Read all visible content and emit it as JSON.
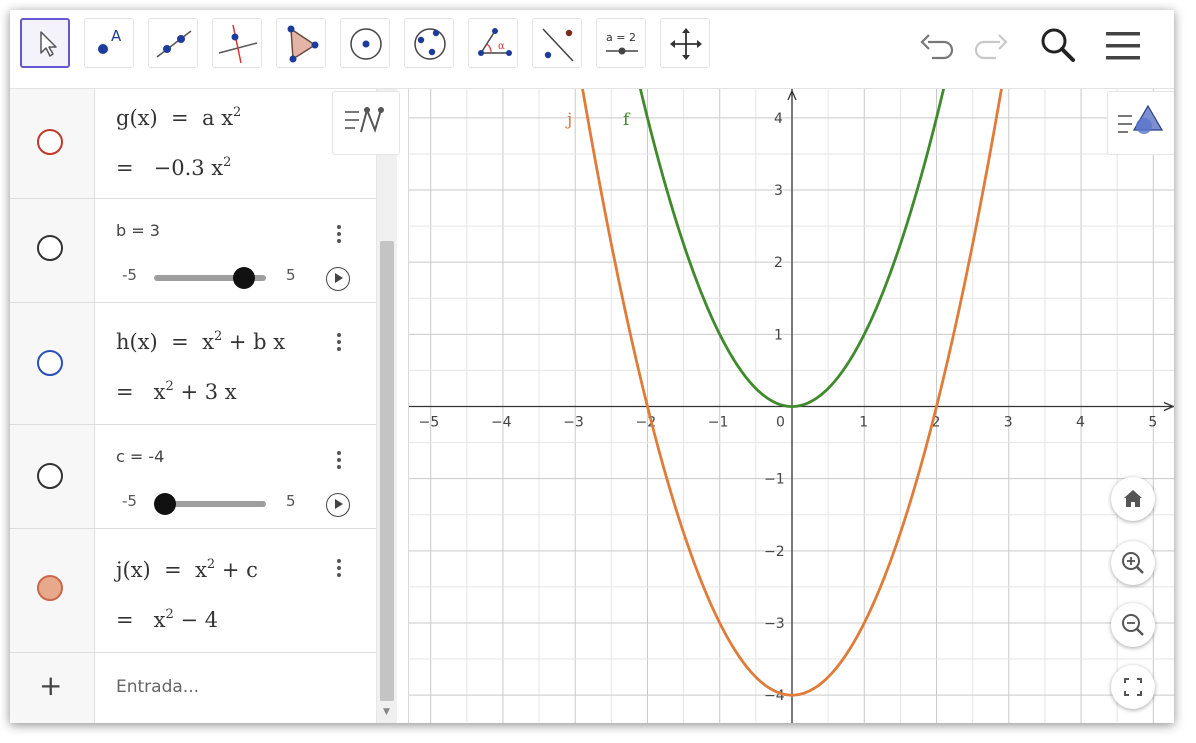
{
  "toolbar": {
    "tools": [
      {
        "name": "move-tool",
        "icon": "arrow-cursor-icon",
        "active": true
      },
      {
        "name": "point-tool",
        "icon": "point-icon",
        "label": "A"
      },
      {
        "name": "line-tool",
        "icon": "line-icon"
      },
      {
        "name": "perpendicular-line-tool",
        "icon": "perpendicular-line-icon"
      },
      {
        "name": "polygon-tool",
        "icon": "polygon-icon"
      },
      {
        "name": "circle-center-point-tool",
        "icon": "circle-center-icon"
      },
      {
        "name": "circle-three-points-tool",
        "icon": "circle-three-points-icon"
      },
      {
        "name": "angle-tool",
        "icon": "angle-icon",
        "label": "α"
      },
      {
        "name": "reflect-tool",
        "icon": "reflect-icon"
      },
      {
        "name": "slider-tool",
        "icon": "slider-icon",
        "label": "a = 2"
      },
      {
        "name": "move-graphics-view-tool",
        "icon": "move-arrows-icon"
      }
    ],
    "right": [
      "undo-icon",
      "redo-icon",
      "search-icon",
      "menu-icon"
    ]
  },
  "algebra": {
    "rows": [
      {
        "kind": "function",
        "marker_color": "#c0392b",
        "marker_filled": false,
        "def_name": "g(x)",
        "def_op": "=",
        "def_body": "a x",
        "def_sup": "2",
        "res_eq": "=",
        "res_body": "−0.3 x",
        "res_sup": "2"
      },
      {
        "kind": "slider",
        "marker_color": "#333333",
        "marker_filled": false,
        "label": "b = 3",
        "min": "-5",
        "max": "5",
        "value": 3,
        "range": [
          -5,
          5
        ]
      },
      {
        "kind": "function",
        "marker_color": "#2a4fb6",
        "marker_filled": false,
        "def_name": "h(x)",
        "def_op": "=",
        "def_body": "x",
        "def_sup": "2",
        "def_tail": " + b x",
        "res_eq": "=",
        "res_body": "x",
        "res_sup": "2",
        "res_tail": " + 3 x"
      },
      {
        "kind": "slider",
        "marker_color": "#333333",
        "marker_filled": false,
        "label": "c = -4",
        "min": "-5",
        "max": "5",
        "value": -4,
        "range": [
          -5,
          5
        ]
      },
      {
        "kind": "function",
        "marker_color": "#e2987a",
        "marker_filled": true,
        "def_name": "j(x)",
        "def_op": "=",
        "def_body": "x",
        "def_sup": "2",
        "def_tail": " + c",
        "res_eq": "=",
        "res_body": "x",
        "res_sup": "2",
        "res_tail": " − 4"
      }
    ],
    "input": {
      "plus": "+",
      "placeholder": "Entrada..."
    }
  },
  "graph": {
    "x_ticks": [
      "−5",
      "−4",
      "−3",
      "−2",
      "−1",
      "0",
      "1",
      "2",
      "3",
      "4",
      "5"
    ],
    "y_ticks": [
      "4",
      "3",
      "2",
      "1",
      "−1",
      "−2",
      "−3",
      "−4"
    ],
    "x_range": [
      -5.3,
      5.3
    ],
    "y_range": [
      -4.4,
      4.4
    ],
    "curves": [
      {
        "label": "j",
        "color": "#e07b39",
        "expr": "x^2 - 4"
      },
      {
        "label": "f",
        "color": "#3e8a2c",
        "expr": "x^2"
      }
    ],
    "view_buttons": [
      "home-icon",
      "zoom-in-icon",
      "zoom-out-icon",
      "fullscreen-icon"
    ]
  }
}
